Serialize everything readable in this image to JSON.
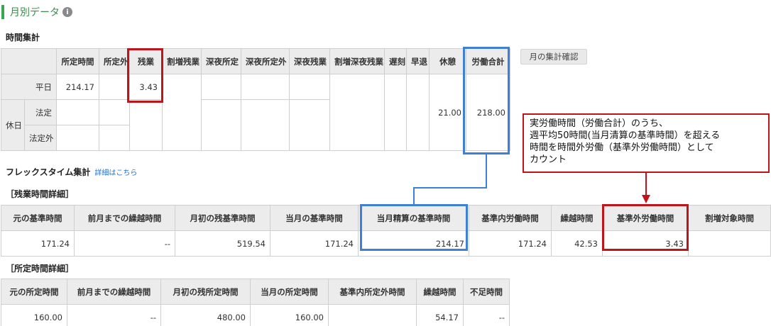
{
  "page": {
    "section_title": "月別データ",
    "info_icon": "info-icon"
  },
  "time_summary": {
    "heading": "時間集計",
    "headers": [
      "所定時間",
      "所定外",
      "残業",
      "割増残業",
      "深夜所定",
      "深夜所定外",
      "深夜残業",
      "割増深夜残業",
      "遅刻",
      "早退",
      "休憩",
      "労働合計"
    ],
    "row_weekday": "平日",
    "group_holiday": "休日",
    "row_legal": "法定",
    "row_non_legal": "法定外",
    "weekday_scheduled": "214.17",
    "weekday_overtime": "3.43",
    "break_total": "21.00",
    "work_total": "218.00"
  },
  "confirm_button": "月の集計確認",
  "flex": {
    "heading": "フレックスタイム集計",
    "detail_link": "詳細はこちら"
  },
  "overtime_detail": {
    "heading": "［残業時間詳細］",
    "headers": [
      "元の基準時間",
      "前月までの繰越時間",
      "月初の残基準時間",
      "当月の基準時間",
      "当月精算の基準時間",
      "基準内労働時間",
      "繰越時間",
      "基準外労働時間",
      "割増対象時間"
    ],
    "values": [
      "171.24",
      "--",
      "519.54",
      "171.24",
      "214.17",
      "171.24",
      "42.53",
      "3.43",
      ""
    ]
  },
  "scheduled_detail": {
    "heading": "［所定時間詳細］",
    "headers": [
      "元の所定時間",
      "前月までの繰越時間",
      "月初の残所定時間",
      "当月の所定時間",
      "基準内所定外時間",
      "繰越時間",
      "不足時間"
    ],
    "values": [
      "160.00",
      "--",
      "480.00",
      "160.00",
      "",
      "54.17",
      "--"
    ]
  },
  "callout": {
    "lines": [
      "実労働時間（労働合計）のうち、",
      "週平均50時間(当月清算の基準時間）を超える",
      "時間を時間外労働（基準外労働時間）として",
      "カウント"
    ]
  },
  "colors": {
    "highlight_red": "#c0141c",
    "highlight_blue": "#3f7fd6",
    "accent_green": "#3aa655"
  }
}
